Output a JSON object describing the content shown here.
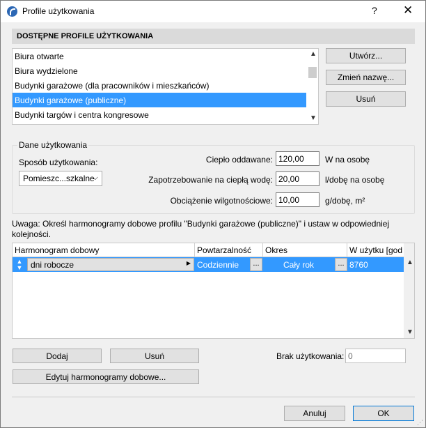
{
  "window": {
    "title": "Profile użytkowania",
    "help": "?",
    "close": "✕"
  },
  "profiles": {
    "header": "DOSTĘPNE PROFILE UŻYTKOWANIA",
    "items": [
      "Biura otwarte",
      "Biura wydzielone",
      "Budynki garażowe (dla pracowników i mieszkańców)",
      "Budynki garażowe (publiczne)",
      "Budynki targów i centra kongresowe"
    ],
    "selected_index": 3,
    "create_label": "Utwórz...",
    "rename_label": "Zmień nazwę...",
    "delete_label": "Usuń"
  },
  "usage_data": {
    "title": "Dane użytkowania",
    "method_label": "Sposób użytkowania:",
    "method_value": "Pomieszc...szkalne",
    "heat_label": "Ciepło oddawane:",
    "heat_value": "120,00",
    "heat_unit": "W na osobę",
    "hot_water_label": "Zapotrzebowanie na ciepłą wodę:",
    "hot_water_value": "20,00",
    "hot_water_unit": "l/dobę na osobę",
    "humidity_label": "Obciążenie wilgotnościowe:",
    "humidity_value": "10,00",
    "humidity_unit": "g/dobę, m²"
  },
  "note": "Uwaga: Określ harmonogramy dobowe profilu \"Budynki garażowe (publiczne)\" i ustaw w odpowiedniej kolejności.",
  "schedule_table": {
    "columns": [
      "Harmonogram dobowy",
      "Powtarzalność",
      "Okres",
      "W użytku [god"
    ],
    "rows": [
      {
        "schedule": "dni robocze",
        "repeat": "Codziennie",
        "period": "Cały rok",
        "in_use": "8760"
      }
    ],
    "dots": "..."
  },
  "actions": {
    "add_label": "Dodaj",
    "remove_label": "Usuń",
    "edit_label": "Edytuj harmonogramy dobowe...",
    "no_usage_label": "Brak użytkowania:",
    "no_usage_value": "0",
    "cancel_label": "Anuluj",
    "ok_label": "OK"
  },
  "colors": {
    "selection": "#3399ff",
    "header_bg": "#dadada",
    "dialog_bg": "#f0f0f0"
  }
}
